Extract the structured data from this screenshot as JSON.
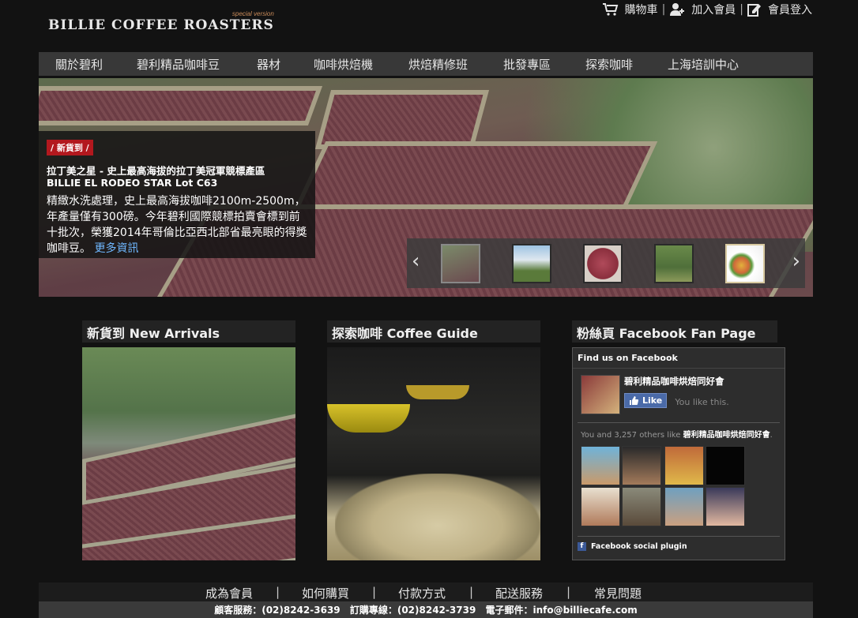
{
  "header": {
    "logo": "BILLIE  COFFEE  ROASTERS",
    "logo_tag": "special version",
    "links": [
      {
        "label": "購物車",
        "icon": "cart-icon"
      },
      {
        "label": "加入會員",
        "icon": "user-add-icon"
      },
      {
        "label": "會員登入",
        "icon": "login-icon"
      }
    ],
    "separator": "|"
  },
  "nav": {
    "items": [
      "關於碧利",
      "碧利精品咖啡豆",
      "器材",
      "咖啡烘焙機",
      "烘焙精修班",
      "批發專區",
      "探索咖啡",
      "上海培訓中心"
    ]
  },
  "hero": {
    "badge": "/ 新貨到 /",
    "title_zh": "拉丁美之星 - 史上最高海拔的拉丁美冠軍競標產區",
    "title_en": "BILLIE EL RODEO STAR Lot C63",
    "description": "精緻水洗處理，史上最高海拔咖啡2100m-2500m，年產量僅有300磅。今年碧利國際競標拍賣會標到前十批次，榮獲2014年哥倫比亞西北部省最亮眼的得獎咖啡豆。",
    "more_link": "更多資訊",
    "prev_arrow": "‹",
    "next_arrow": "›"
  },
  "sections": {
    "new_arrivals": "新貨到 New Arrivals",
    "coffee_guide": "探索咖啡 Coffee Guide",
    "fan_page": "粉絲頁 Facebook Fan Page"
  },
  "facebook": {
    "header": "Find us on Facebook",
    "page_name": "碧利精品咖啡烘焙同好會",
    "like_label": "Like",
    "you_like": "You like this.",
    "others_prefix": "You and 3,257 others like",
    "others_page": "碧利精品咖啡烘焙同好會",
    "others_suffix": ".",
    "plugin_label": "Facebook social plugin"
  },
  "footer": {
    "links": [
      "成為會員",
      "如何購買",
      "付款方式",
      "配送服務",
      "常見問題"
    ],
    "separator": "|",
    "contact": [
      "顧客服務：(02)8242-3639",
      "訂購專線：(02)8242-3739",
      "電子郵件：info@billiecafe.com"
    ]
  },
  "colors": {
    "background": "#121212",
    "nav_bg": "#383838",
    "badge_red": "#b3181e",
    "link_blue": "#6fb7ff",
    "fb_blue": "#4a6aa8"
  }
}
